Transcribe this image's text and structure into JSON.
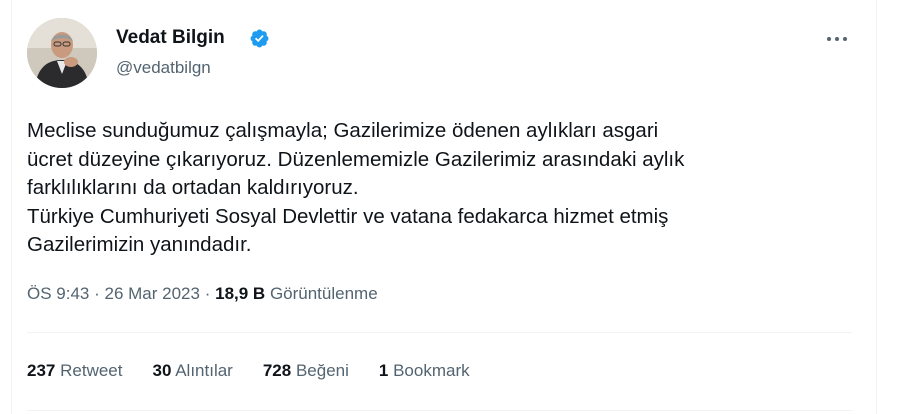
{
  "author": {
    "name": "Vedat Bilgin",
    "handle": "@vedatbilgn",
    "verified": true,
    "verified_color": "#1d9bf0"
  },
  "tweet": {
    "text": "Meclise sunduğumuz çalışmayla; Gazilerimize ödenen aylıkları asgari\nücret düzeyine çıkarıyoruz. Düzenlememizle Gazilerimiz arasındaki aylık\nfarklılıklarını da ortadan kaldırıyoruz.\nTürkiye Cumhuriyeti Sosyal Devlettir ve vatana fedakarca hizmet etmiş\nGazilerimizin yanındadır."
  },
  "meta": {
    "time": "ÖS 9:43",
    "separator": "·",
    "date": "26 Mar 2023",
    "views_count": "18,9 B",
    "views_label": "Görüntülenme"
  },
  "stats": [
    {
      "count": "237",
      "label": "Retweet"
    },
    {
      "count": "30",
      "label": "Alıntılar"
    },
    {
      "count": "728",
      "label": "Beğeni"
    },
    {
      "count": "1",
      "label": "Bookmark"
    }
  ],
  "icons": {
    "verified": "verified-badge-icon",
    "more": "more-options-icon"
  }
}
